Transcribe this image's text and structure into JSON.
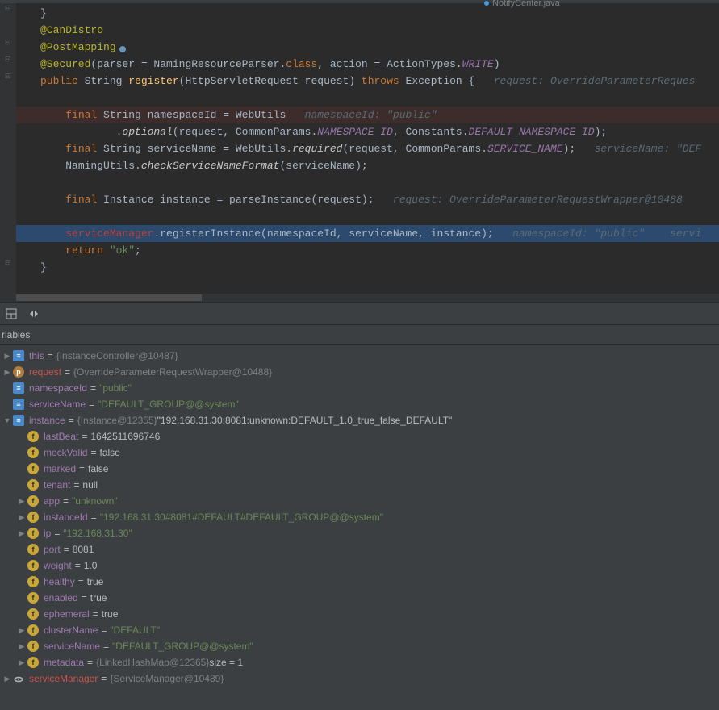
{
  "tab": {
    "label": "NotifyCenter.java"
  },
  "code": {
    "l1": {
      "ann": "@CanDistro"
    },
    "l2": {
      "ann": "@PostMapping"
    },
    "l3": {
      "ann": "@Secured",
      "rest": "(parser = NamingResourceParser.",
      "cls": "class",
      "p2": ", action = ActionTypes.",
      "write": "WRITE",
      "end": ")"
    },
    "l4": {
      "kw": "public",
      "s": " String ",
      "fn": "register",
      "p": "(HttpServletRequest request) ",
      "th": "throws",
      "ex": " Exception {",
      "hint": "   request: OverrideParameterReques"
    },
    "l5": {
      "kw": "final",
      "s": " String namespaceId = WebUtils",
      "hint": "   namespaceId: \"public\""
    },
    "l6": {
      "m": "optional",
      "p": "(request, CommonParams.",
      "c1": "NAMESPACE_ID",
      "p2": ", Constants.",
      "c2": "DEFAULT_NAMESPACE_ID",
      "end": ");"
    },
    "l7": {
      "kw": "final",
      "s": " String serviceName = WebUtils.",
      "m": "required",
      "p": "(request, CommonParams.",
      "c": "SERVICE_NAME",
      "end": ");",
      "hint": "   serviceName: \"DEF"
    },
    "l8": {
      "s": "NamingUtils.",
      "m": "checkServiceNameFormat",
      "p": "(serviceName);"
    },
    "l9": {
      "kw": "final",
      "s": " Instance instance = parseInstance(request);",
      "hint": "   request: OverrideParameterRequestWrapper@10488"
    },
    "l10": {
      "err": "serviceManager",
      "s": ".registerInstance(namespaceId, serviceName, instance);",
      "hint": "   namespaceId: \"public\"    servi"
    },
    "l11": {
      "kw": "return",
      "str": " \"ok\"",
      "end": ";"
    },
    "l12": {
      "brace": "}"
    }
  },
  "debug": {
    "tab": "riables",
    "vars": [
      {
        "lvl": 0,
        "arrow": "closed",
        "icon": "blue",
        "iconTxt": "≡",
        "name": "this",
        "eq": "=",
        "val": "{InstanceController@10487}",
        "valCls": "gray"
      },
      {
        "lvl": 0,
        "arrow": "closed",
        "icon": "orange",
        "iconTxt": "p",
        "name": "request",
        "nameCls": "red",
        "eq": "=",
        "val": "{OverrideParameterRequestWrapper@10488}",
        "valCls": "gray"
      },
      {
        "lvl": 0,
        "arrow": "none",
        "icon": "blue",
        "iconTxt": "≡",
        "name": "namespaceId",
        "eq": "=",
        "val": "\"public\"",
        "valCls": "str"
      },
      {
        "lvl": 0,
        "arrow": "none",
        "icon": "blue",
        "iconTxt": "≡",
        "name": "serviceName",
        "eq": "=",
        "val": "\"DEFAULT_GROUP@@system\"",
        "valCls": "str"
      },
      {
        "lvl": 0,
        "arrow": "open",
        "icon": "blue",
        "iconTxt": "≡",
        "name": "instance",
        "eq": "=",
        "val": "{Instance@12355}",
        "valCls": "gray",
        "val2": " \"192.168.31.30:8081:unknown:DEFAULT_1.0_true_false_DEFAULT\""
      },
      {
        "lvl": 1,
        "arrow": "none",
        "icon": "yellow",
        "iconTxt": "f",
        "name": "lastBeat",
        "eq": "=",
        "val": "1642511696746"
      },
      {
        "lvl": 1,
        "arrow": "none",
        "icon": "yellow",
        "iconTxt": "f",
        "name": "mockValid",
        "eq": "=",
        "val": "false"
      },
      {
        "lvl": 1,
        "arrow": "none",
        "icon": "yellow",
        "iconTxt": "f",
        "name": "marked",
        "eq": "=",
        "val": "false"
      },
      {
        "lvl": 1,
        "arrow": "none",
        "icon": "yellow",
        "iconTxt": "f",
        "name": "tenant",
        "eq": "=",
        "val": "null"
      },
      {
        "lvl": 1,
        "arrow": "closed",
        "icon": "yellow",
        "iconTxt": "f",
        "name": "app",
        "eq": "=",
        "val": "\"unknown\"",
        "valCls": "str"
      },
      {
        "lvl": 1,
        "arrow": "closed",
        "icon": "yellow",
        "iconTxt": "f",
        "name": "instanceId",
        "eq": "=",
        "val": "\"192.168.31.30#8081#DEFAULT#DEFAULT_GROUP@@system\"",
        "valCls": "str"
      },
      {
        "lvl": 1,
        "arrow": "closed",
        "icon": "yellow",
        "iconTxt": "f",
        "name": "ip",
        "eq": "=",
        "val": "\"192.168.31.30\"",
        "valCls": "str"
      },
      {
        "lvl": 1,
        "arrow": "none",
        "icon": "yellow",
        "iconTxt": "f",
        "name": "port",
        "eq": "=",
        "val": "8081"
      },
      {
        "lvl": 1,
        "arrow": "none",
        "icon": "yellow",
        "iconTxt": "f",
        "name": "weight",
        "eq": "=",
        "val": "1.0"
      },
      {
        "lvl": 1,
        "arrow": "none",
        "icon": "yellow",
        "iconTxt": "f",
        "name": "healthy",
        "eq": "=",
        "val": "true"
      },
      {
        "lvl": 1,
        "arrow": "none",
        "icon": "yellow",
        "iconTxt": "f",
        "name": "enabled",
        "eq": "=",
        "val": "true"
      },
      {
        "lvl": 1,
        "arrow": "none",
        "icon": "yellow",
        "iconTxt": "f",
        "name": "ephemeral",
        "eq": "=",
        "val": "true"
      },
      {
        "lvl": 1,
        "arrow": "closed",
        "icon": "yellow",
        "iconTxt": "f",
        "name": "clusterName",
        "eq": "=",
        "val": "\"DEFAULT\"",
        "valCls": "str"
      },
      {
        "lvl": 1,
        "arrow": "closed",
        "icon": "yellow",
        "iconTxt": "f",
        "name": "serviceName",
        "eq": "=",
        "val": "\"DEFAULT_GROUP@@system\"",
        "valCls": "str"
      },
      {
        "lvl": 1,
        "arrow": "closed",
        "icon": "yellow",
        "iconTxt": "f",
        "name": "metadata",
        "eq": "=",
        "val": "{LinkedHashMap@12365}",
        "valCls": "gray",
        "val2": "  size = 1"
      },
      {
        "lvl": 0,
        "arrow": "closed",
        "icon": "glasses",
        "iconTxt": "ᯣ",
        "name": "serviceManager",
        "nameCls": "red",
        "eq": "=",
        "val": "{ServiceManager@10489}",
        "valCls": "gray"
      }
    ]
  }
}
